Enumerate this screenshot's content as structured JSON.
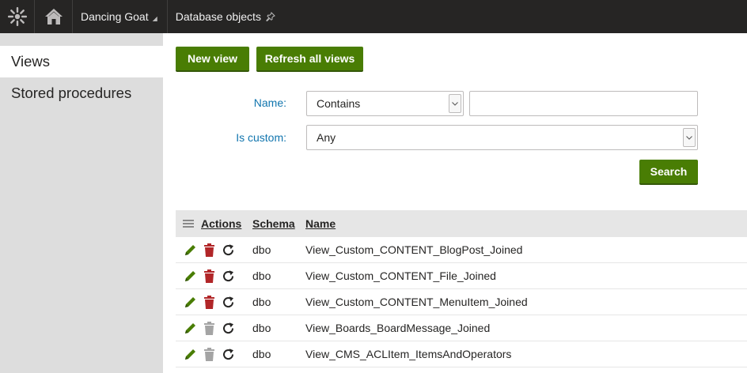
{
  "topbar": {
    "logo_icon": "kentico-logo-icon",
    "home_icon": "home-icon",
    "site_name": "Dancing Goat",
    "app_title": "Database objects",
    "pin_icon": "pin-icon"
  },
  "sidebar": {
    "items": [
      {
        "label": "Views",
        "active": true
      },
      {
        "label": "Stored procedures",
        "active": false
      }
    ]
  },
  "toolbar": {
    "new_view_label": "New view",
    "refresh_label": "Refresh all views"
  },
  "filter": {
    "name_label": "Name:",
    "name_operator": "Contains",
    "name_value": "",
    "custom_label": "Is custom:",
    "custom_value": "Any",
    "search_label": "Search"
  },
  "grid": {
    "headers": {
      "actions": "Actions",
      "schema": "Schema",
      "name": "Name"
    },
    "rows": [
      {
        "schema": "dbo",
        "name": "View_Custom_CONTENT_BlogPost_Joined",
        "delete_enabled": true
      },
      {
        "schema": "dbo",
        "name": "View_Custom_CONTENT_File_Joined",
        "delete_enabled": true
      },
      {
        "schema": "dbo",
        "name": "View_Custom_CONTENT_MenuItem_Joined",
        "delete_enabled": true
      },
      {
        "schema": "dbo",
        "name": "View_Boards_BoardMessage_Joined",
        "delete_enabled": false
      },
      {
        "schema": "dbo",
        "name": "View_CMS_ACLItem_ItemsAndOperators",
        "delete_enabled": false
      }
    ]
  },
  "colors": {
    "topbar_bg": "#262524",
    "sidebar_bg": "#dddddd",
    "accent_green": "#497d04",
    "label_blue": "#1175ae",
    "delete_red": "#b12628",
    "delete_disabled": "#a4a4a4"
  }
}
